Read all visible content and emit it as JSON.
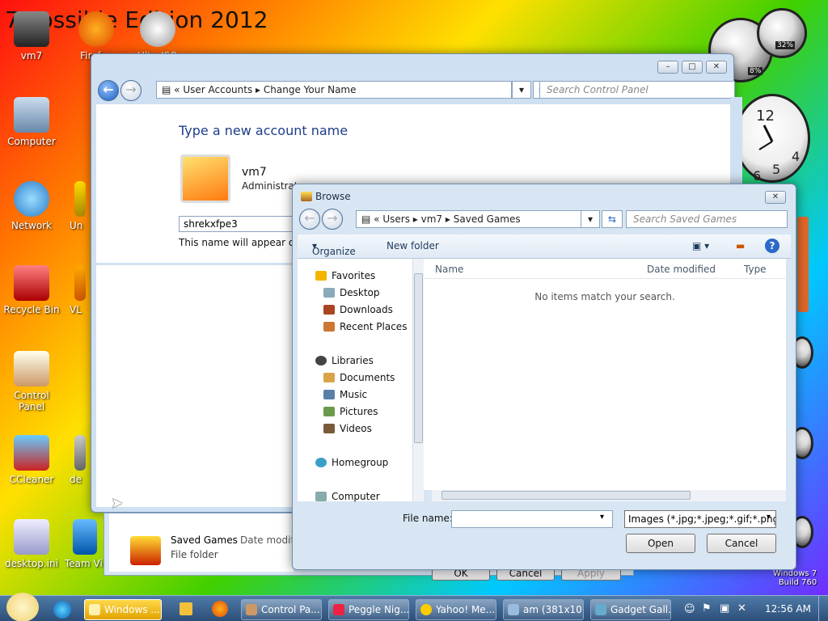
{
  "desktop": {
    "banner": "7 Possible Edition 2012",
    "icons": [
      {
        "label": "vm7"
      },
      {
        "label": "Firefox"
      },
      {
        "label": "UltraISO"
      },
      {
        "label": "Computer"
      },
      {
        "label": "Network"
      },
      {
        "label": "Recycle Bin"
      },
      {
        "label": "Control Panel"
      },
      {
        "label": "CCleaner"
      },
      {
        "label": "desktop.ini"
      },
      {
        "label": "Team Vi"
      },
      {
        "label": "VL"
      },
      {
        "label": "Un"
      },
      {
        "label": "de"
      }
    ],
    "watermark": "Windows 7\nBuild 760"
  },
  "gadgets": {
    "cpu_percent_label": "32%",
    "ram_percent_label": "8%"
  },
  "account_window": {
    "breadcrumb": [
      "User Accounts",
      "Change Your Name"
    ],
    "search_placeholder": "Search Control Panel",
    "heading": "Type a new account name",
    "user_name": "vm7",
    "user_role": "Administrator",
    "name_input_value": "shrekxfpe3",
    "hint": "This name will appear on the Welcome screen",
    "saved_games_name": "Saved Games",
    "saved_games_type": "File folder",
    "saved_games_col": "Date modified",
    "ok_label": "OK",
    "cancel_label": "Cancel",
    "apply_label": "Apply"
  },
  "browse": {
    "title": "Browse",
    "breadcrumb": [
      "Users",
      "vm7",
      "Saved Games"
    ],
    "search_placeholder": "Search Saved Games",
    "organize_label": "Organize",
    "new_folder_label": "New folder",
    "nav": {
      "favorites": "Favorites",
      "fav_items": [
        "Desktop",
        "Downloads",
        "Recent Places"
      ],
      "libraries": "Libraries",
      "lib_items": [
        "Documents",
        "Music",
        "Pictures",
        "Videos"
      ],
      "homegroup": "Homegroup",
      "computer": "Computer"
    },
    "columns": [
      "Name",
      "Date modified",
      "Type"
    ],
    "empty_message": "No items match your search.",
    "file_name_label": "File name:",
    "file_name_value": "",
    "filter": "Images (*.jpg;*.jpeg;*.gif;*.png;",
    "open_label": "Open",
    "cancel_label": "Cancel"
  },
  "taskbar": {
    "tasks": [
      {
        "label": "Windows ..."
      },
      {
        "label": "Control Pa..."
      },
      {
        "label": "Peggle Nig..."
      },
      {
        "label": "Yahoo! Me..."
      },
      {
        "label": "am (381x10..."
      },
      {
        "label": "Gadget Gall..."
      }
    ],
    "clock": "12:56 AM"
  }
}
